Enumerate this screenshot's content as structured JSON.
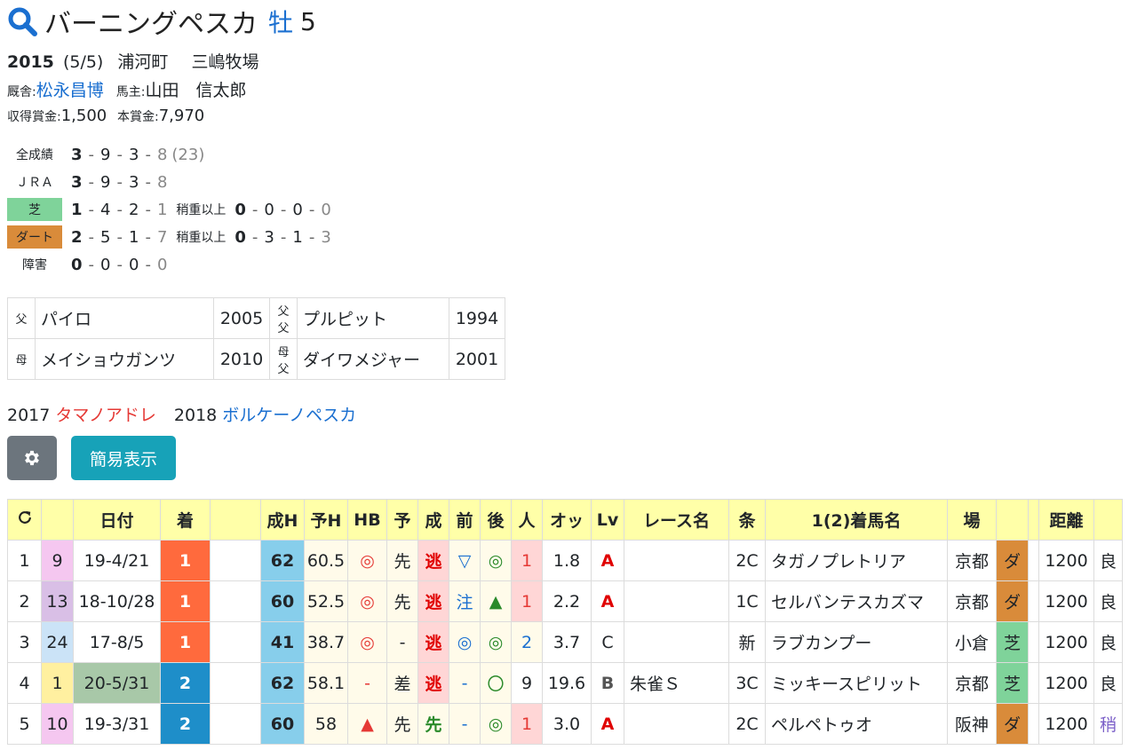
{
  "header": {
    "name": "バーニングペスカ",
    "sex": "牡",
    "age": "5"
  },
  "profile": {
    "birth_year": "2015",
    "birth_date": "(5/5)",
    "area": "浦河町",
    "breeder": "三嶋牧場",
    "trainer_label": "厩舎:",
    "trainer": "松永昌博",
    "owner_label": "馬主:",
    "owner": "山田　信太郎",
    "earn_label": "収得賞金:",
    "earn": "1,500",
    "prize_label": "本賞金:",
    "prize": "7,970"
  },
  "records": [
    {
      "label": "全成績",
      "v": [
        "3",
        "9",
        "3",
        "8"
      ],
      "extra": "(23)"
    },
    {
      "label": "ＪＲＡ",
      "v": [
        "3",
        "9",
        "3",
        "8"
      ]
    },
    {
      "label": "芝",
      "v": [
        "1",
        "4",
        "2",
        "1"
      ],
      "sub": "稍重以上",
      "v2": [
        "0",
        "0",
        "0",
        "0"
      ]
    },
    {
      "label": "ダート",
      "v": [
        "2",
        "5",
        "1",
        "7"
      ],
      "sub": "稍重以上",
      "v2": [
        "0",
        "3",
        "1",
        "3"
      ]
    },
    {
      "label": "障害",
      "v": [
        "0",
        "0",
        "0",
        "0"
      ]
    }
  ],
  "pedigree": {
    "sire_label": "父",
    "sire": "パイロ",
    "sire_year": "2005",
    "ss_label": "父父",
    "ss": "プルピット",
    "ss_year": "1994",
    "dam_label": "母",
    "dam": "メイショウガンツ",
    "dam_year": "2010",
    "ds_label": "母父",
    "ds": "ダイワメジャー",
    "ds_year": "2001"
  },
  "progeny": [
    {
      "year": "2017",
      "name": "タマノアドレ"
    },
    {
      "year": "2018",
      "name": "ボルケーノペスカ"
    }
  ],
  "buttons": {
    "simple": "簡易表示"
  },
  "table": {
    "headers": [
      "日付",
      "着",
      "成H",
      "予H",
      "HB",
      "予",
      "成",
      "前",
      "後",
      "人",
      "オッ",
      "Lv",
      "レース名",
      "条",
      "1(2)着馬名",
      "場",
      "距離"
    ],
    "rows": [
      [
        "1",
        "9",
        "19-4/21",
        "1",
        "62",
        "60.5",
        "◎",
        "先",
        "逃",
        "▽",
        "◎",
        "1",
        "1.8",
        "A",
        "",
        "2C",
        "タガノプレトリア",
        "京都",
        "ダ",
        "1200",
        "良"
      ],
      [
        "2",
        "13",
        "18-10/28",
        "1",
        "60",
        "52.5",
        "◎",
        "先",
        "逃",
        "注",
        "▲",
        "1",
        "2.2",
        "A",
        "",
        "1C",
        "セルバンテスカズマ",
        "京都",
        "ダ",
        "1200",
        "良"
      ],
      [
        "3",
        "24",
        "17-8/5",
        "1",
        "41",
        "38.7",
        "◎",
        "-",
        "逃",
        "◎",
        "◎",
        "2",
        "3.7",
        "C",
        "",
        "新",
        "ラブカンプー",
        "小倉",
        "芝",
        "1200",
        "良"
      ],
      [
        "4",
        "1",
        "20-5/31",
        "2",
        "62",
        "58.1",
        "-",
        "差",
        "逃",
        "-",
        "〇",
        "9",
        "19.6",
        "B",
        "朱雀Ｓ",
        "3C",
        "ミッキースピリット",
        "京都",
        "芝",
        "1200",
        "良"
      ],
      [
        "5",
        "10",
        "19-3/31",
        "2",
        "60",
        "58",
        "▲",
        "先",
        "先",
        "-",
        "◎",
        "1",
        "3.0",
        "A",
        "",
        "2C",
        "ペルペトゥオ",
        "阪神",
        "ダ",
        "1200",
        "稍"
      ]
    ]
  }
}
